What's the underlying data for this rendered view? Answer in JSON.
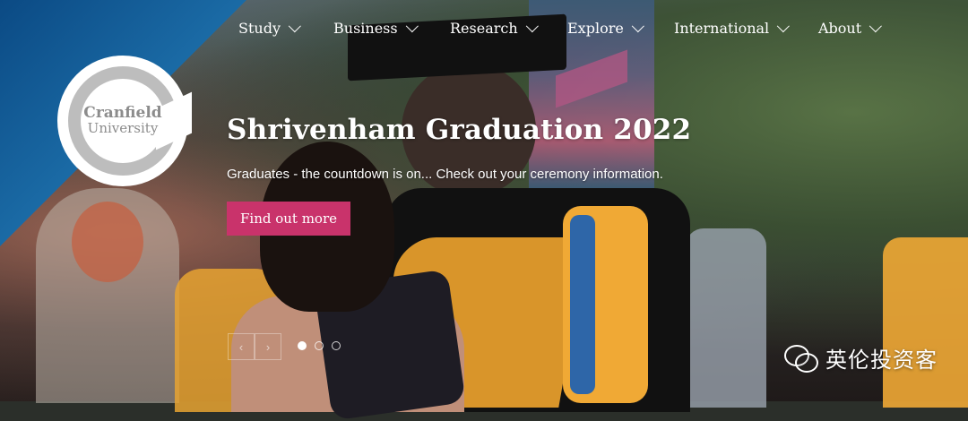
{
  "nav": {
    "items": [
      {
        "label": "Study"
      },
      {
        "label": "Business"
      },
      {
        "label": "Research"
      },
      {
        "label": "Explore"
      },
      {
        "label": "International"
      },
      {
        "label": "About"
      }
    ]
  },
  "logo": {
    "line1": "Cranfield",
    "line2": "University"
  },
  "slide": {
    "title": "Shrivenham Graduation 2022",
    "subtitle": "Graduates - the countdown is on... Check out your ceremony information.",
    "cta_label": "Find out more"
  },
  "carousel": {
    "prev_symbol": "‹",
    "next_symbol": "›",
    "active_index": 1,
    "total": 3
  },
  "watermark": {
    "text": "英伦投资客",
    "icon": "wechat-icon"
  },
  "colors": {
    "corner_blue": "#1c6ea9",
    "cta_pink": "#c9336b"
  }
}
